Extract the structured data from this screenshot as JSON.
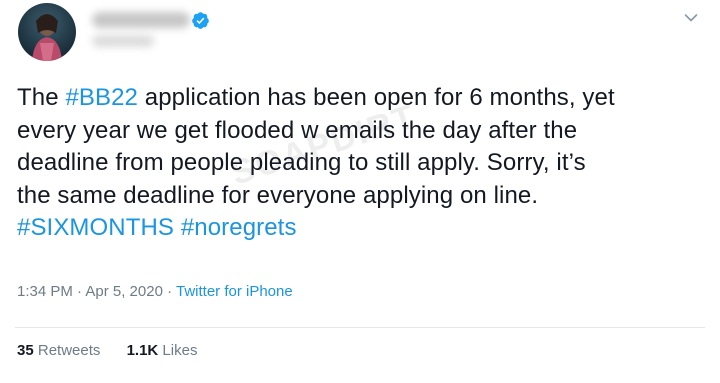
{
  "tweet": {
    "text_lines": [
      [
        {
          "t": "The ",
          "tag": false
        },
        {
          "t": "#BB22",
          "tag": true
        },
        {
          "t": " application has been open for 6 months, yet",
          "tag": false
        }
      ],
      [
        {
          "t": "every year we get flooded w emails the day after the",
          "tag": false
        }
      ],
      [
        {
          "t": "deadline from people pleading to still apply.  Sorry, it’s",
          "tag": false
        }
      ],
      [
        {
          "t": "the same deadline for everyone applying on line.",
          "tag": false
        }
      ],
      [
        {
          "t": "#SIXMONTHS",
          "tag": true
        },
        {
          "t": " ",
          "tag": false
        },
        {
          "t": "#noregrets",
          "tag": true
        }
      ]
    ],
    "timestamp": "1:34 PM · Apr 5, 2020",
    "separator": " · ",
    "source": "Twitter for iPhone",
    "retweets_count": "35",
    "retweets_label": "Retweets",
    "likes_count": "1.1K",
    "likes_label": "Likes",
    "watermark": "SOAPDIRT",
    "verified_icon": "verified-badge-icon",
    "menu_icon": "chevron-down-icon"
  },
  "colors": {
    "hashtag": "#1b95e0",
    "text": "#141823",
    "meta": "#6e7b88",
    "verified": "#1da1f2"
  }
}
